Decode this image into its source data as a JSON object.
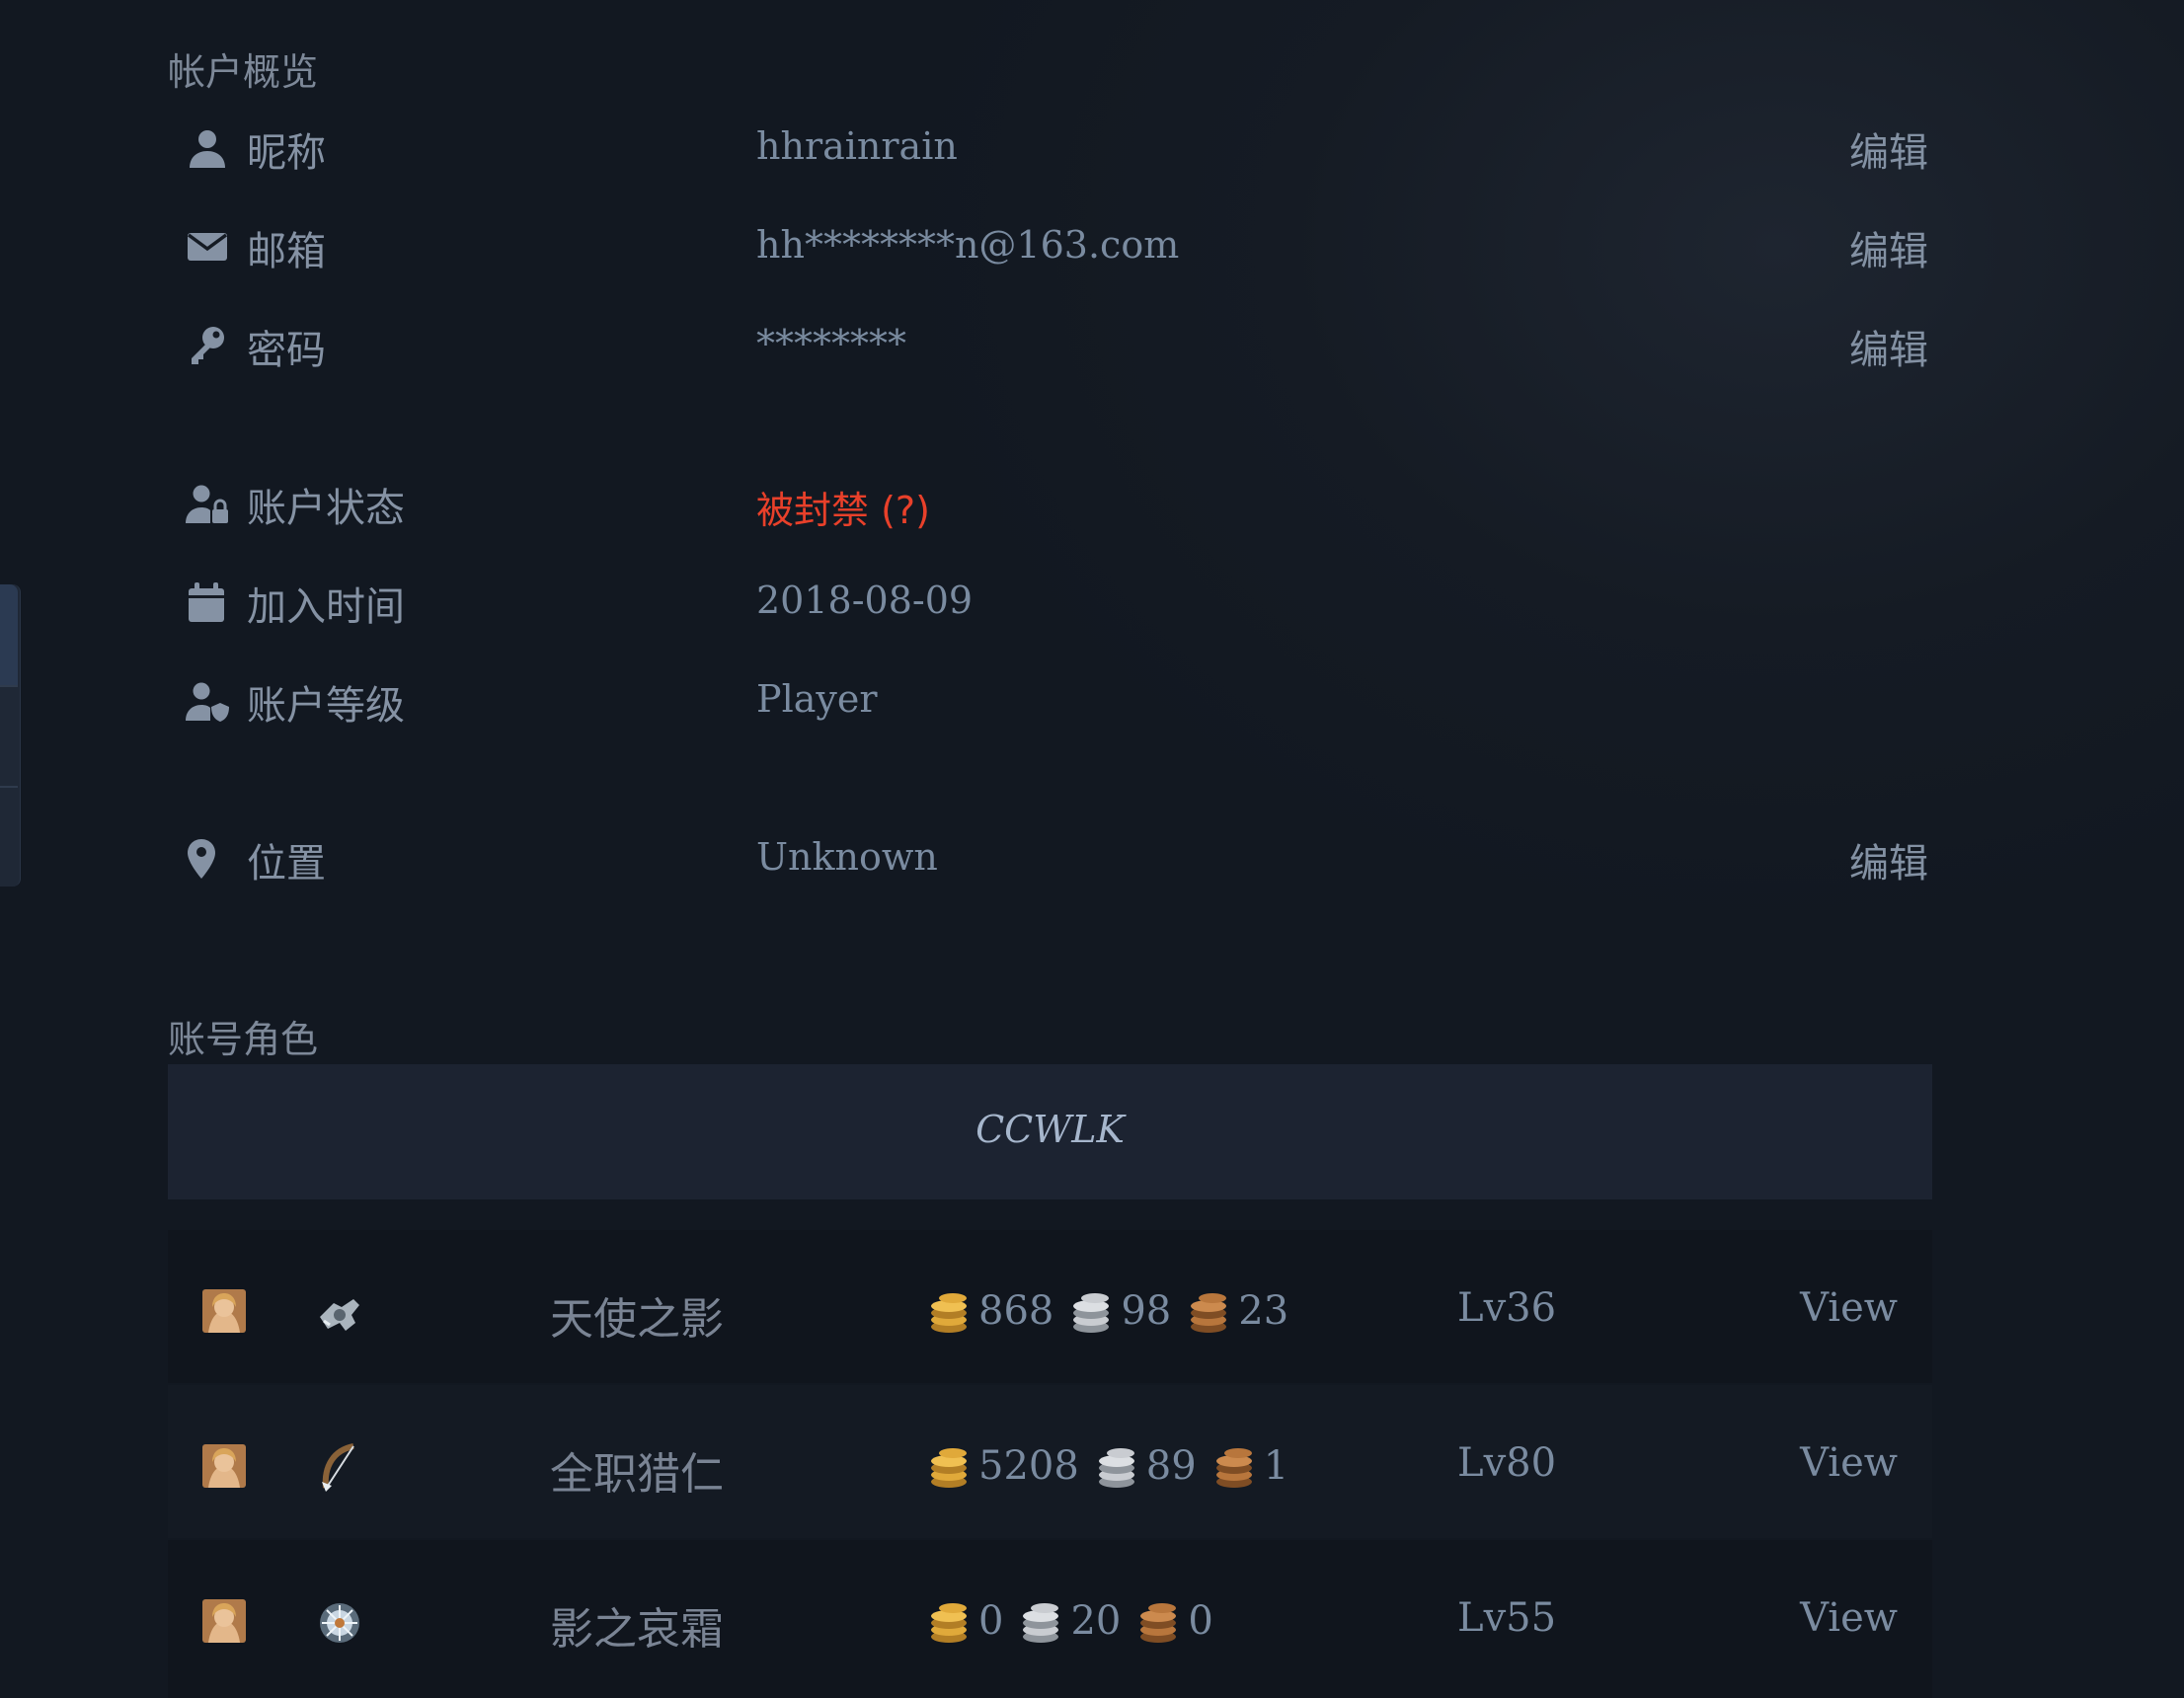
{
  "account_overview": {
    "title": "帐户概览",
    "rows": [
      {
        "label": "昵称",
        "value": "hhrainrain",
        "edit": "编辑",
        "icon": "user-icon"
      },
      {
        "label": "邮箱",
        "value": "hh********n@163.com",
        "edit": "编辑",
        "icon": "envelope-icon"
      },
      {
        "label": "密码",
        "value": "********",
        "edit": "编辑",
        "icon": "key-icon"
      },
      {
        "label": "账户状态",
        "value": "被封禁 (?)",
        "icon": "user-lock-icon"
      },
      {
        "label": "加入时间",
        "value": "2018-08-09",
        "icon": "calendar-icon"
      },
      {
        "label": "账户等级",
        "value": "Player",
        "icon": "user-shield-icon"
      },
      {
        "label": "位置",
        "value": "Unknown",
        "edit": "编辑",
        "icon": "map-marker-icon"
      }
    ]
  },
  "characters_section": {
    "title": "账号角色",
    "realm": "CCWLK",
    "characters": [
      {
        "name": "天使之影",
        "gold": "868",
        "silver": "98",
        "copper": "23",
        "level": "Lv36",
        "action": "View",
        "spec_icon": "cloth-armor-icon"
      },
      {
        "name": "全职猎仁",
        "gold": "5208",
        "silver": "89",
        "copper": "1",
        "level": "Lv80",
        "action": "View",
        "spec_icon": "bow-icon"
      },
      {
        "name": "影之哀霜",
        "gold": "0",
        "silver": "20",
        "copper": "0",
        "level": "Lv55",
        "action": "View",
        "spec_icon": "frost-orb-icon"
      }
    ]
  },
  "colors": {
    "background": "#151b24",
    "banned_status": "#e8402a",
    "gold_coin": "#e0a93a",
    "silver_coin": "#c9ccd1",
    "copper_coin": "#b8763c"
  }
}
